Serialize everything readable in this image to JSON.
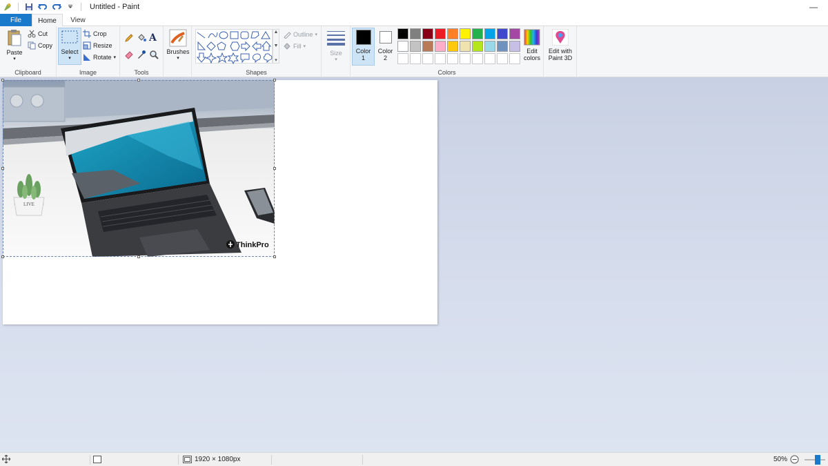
{
  "window": {
    "title": "Untitled - Paint"
  },
  "tabs": {
    "file": "File",
    "home": "Home",
    "view": "View"
  },
  "clipboard": {
    "paste": "Paste",
    "cut": "Cut",
    "copy": "Copy",
    "label": "Clipboard"
  },
  "image": {
    "select": "Select",
    "crop": "Crop",
    "resize": "Resize",
    "rotate": "Rotate",
    "label": "Image"
  },
  "tools": {
    "label": "Tools"
  },
  "brushes": {
    "label": "Brushes"
  },
  "shapes": {
    "outline": "Outline",
    "fill": "Fill",
    "label": "Shapes"
  },
  "size": {
    "label": "Size"
  },
  "colors": {
    "color1_line1": "Color",
    "color1_line2": "1",
    "color2_line1": "Color",
    "color2_line2": "2",
    "edit_line1": "Edit",
    "edit_line2": "colors",
    "label": "Colors",
    "color1": "#000000",
    "color2": "#ffffff",
    "palette": [
      "#000000",
      "#7f7f7f",
      "#880015",
      "#ed1c24",
      "#ff7f27",
      "#fff200",
      "#22b14c",
      "#00a2e8",
      "#3f48cc",
      "#a349a4",
      "#ffffff",
      "#c3c3c3",
      "#b97a57",
      "#ffaec9",
      "#ffc90e",
      "#efe4b0",
      "#b5e61d",
      "#99d9ea",
      "#7092be",
      "#c8bfe7",
      "#ffffff",
      "#ffffff",
      "#ffffff",
      "#ffffff",
      "#ffffff",
      "#ffffff",
      "#ffffff",
      "#ffffff",
      "#ffffff",
      "#ffffff"
    ]
  },
  "paint3d": {
    "line1": "Edit with",
    "line2": "Paint 3D"
  },
  "canvas": {
    "watermark": "ThinkPro",
    "pot_text": "LIVE"
  },
  "status": {
    "dimensions": "1920 × 1080px",
    "zoom": "50%"
  },
  "icons": [
    "paint-app-icon",
    "save-icon",
    "undo-icon",
    "redo-icon",
    "paste-icon",
    "cut-icon",
    "copy-icon",
    "select-icon",
    "crop-icon",
    "resize-icon",
    "rotate-icon",
    "pencil-icon",
    "fill-bucket-icon",
    "text-icon",
    "eraser-icon",
    "color-picker-icon",
    "magnifier-icon",
    "brush-icon",
    "size-icon",
    "edit-colors-icon",
    "paint3d-icon",
    "move-cursor-icon",
    "selection-size-icon",
    "canvas-size-icon"
  ]
}
